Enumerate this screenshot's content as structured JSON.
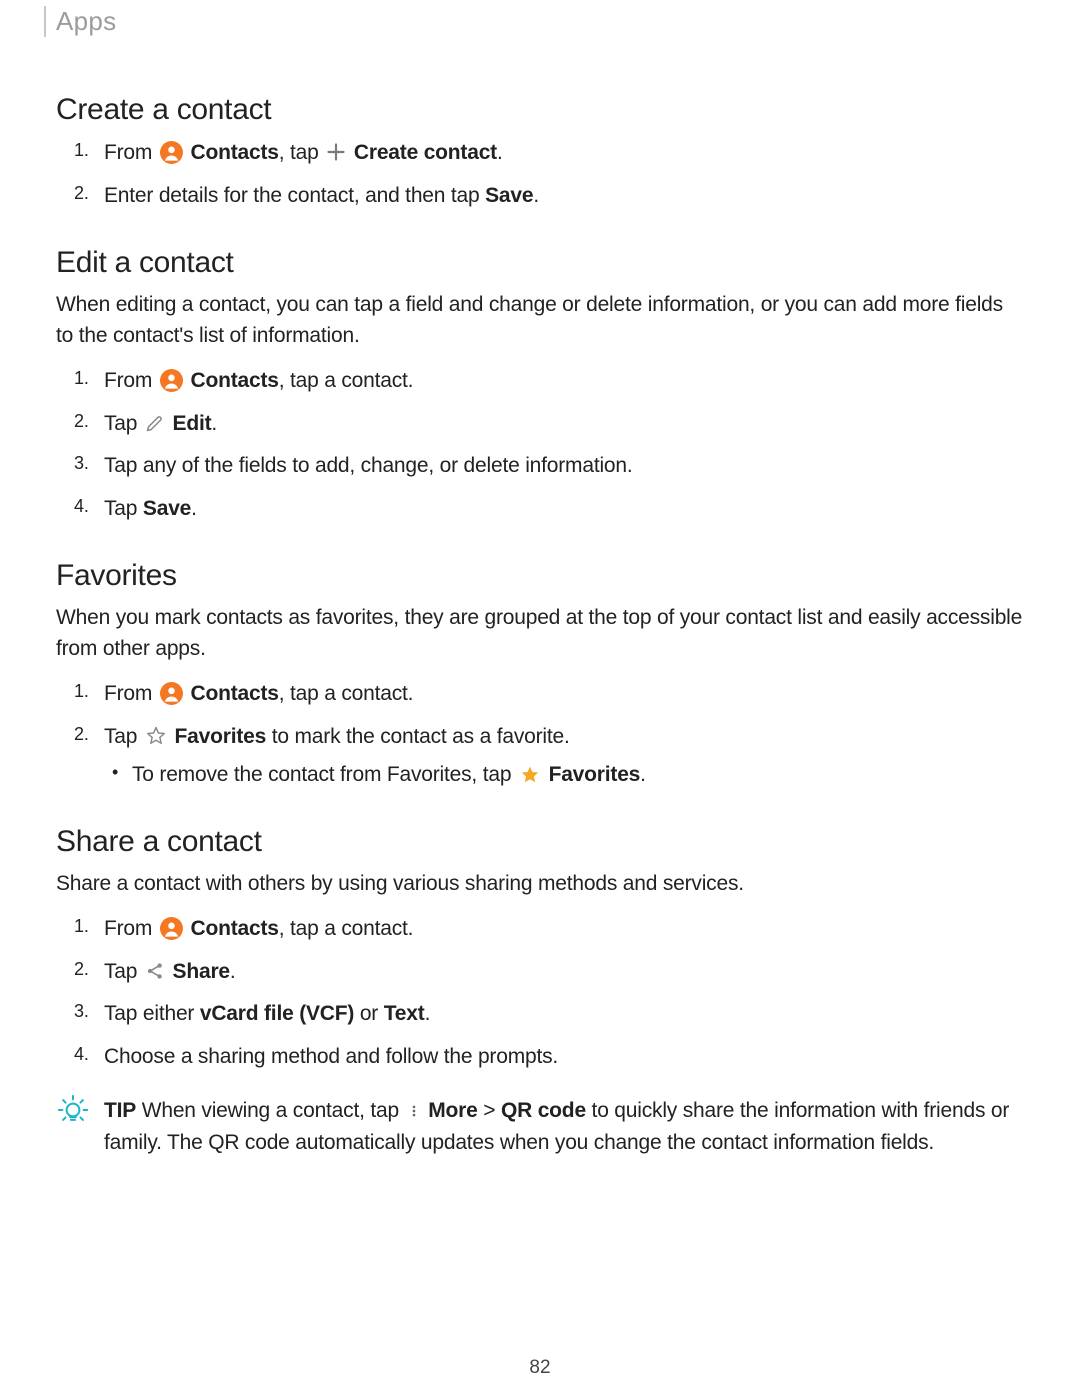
{
  "breadcrumb": "Apps",
  "page_number": "82",
  "sections": {
    "create": {
      "title": "Create a contact",
      "step1_from": "From",
      "step1_contacts": "Contacts",
      "step1_tap": ", tap",
      "step1_create": "Create contact",
      "step1_period": ".",
      "step2_a": "Enter details for the contact, and then tap ",
      "step2_save": "Save",
      "step2_b": "."
    },
    "edit": {
      "title": "Edit a contact",
      "intro": "When editing a contact, you can tap a field and change or delete information, or you can add more fields to the contact's list of information.",
      "step1_from": "From",
      "step1_contacts": "Contacts",
      "step1_rest": ", tap a contact.",
      "step2_tap": "Tap",
      "step2_edit": "Edit",
      "step2_period": ".",
      "step3": "Tap any of the fields to add, change, or delete information.",
      "step4_a": "Tap ",
      "step4_save": "Save",
      "step4_b": "."
    },
    "fav": {
      "title": "Favorites",
      "intro": "When you mark contacts as favorites, they are grouped at the top of your contact list and easily accessible from other apps.",
      "step1_from": "From",
      "step1_contacts": "Contacts",
      "step1_rest": ", tap a contact.",
      "step2_tap": "Tap",
      "step2_fav": "Favorites",
      "step2_rest": " to mark the contact as a favorite.",
      "sub_a": "To remove the contact from Favorites, tap",
      "sub_fav": "Favorites",
      "sub_b": "."
    },
    "share": {
      "title": "Share a contact",
      "intro": "Share a contact with others by using various sharing methods and services.",
      "step1_from": "From",
      "step1_contacts": "Contacts",
      "step1_rest": ", tap a contact.",
      "step2_tap": "Tap",
      "step2_share": "Share",
      "step2_period": ".",
      "step3_a": "Tap either ",
      "step3_vcf": "vCard file (VCF)",
      "step3_or": " or ",
      "step3_text": "Text",
      "step3_b": ".",
      "step4": "Choose a sharing method and follow the prompts."
    },
    "tip": {
      "label": "TIP",
      "a": "  When viewing a contact, tap",
      "more": "More",
      "gt": " > ",
      "qr": "QR code",
      "b": " to quickly share the information with friends or family. The QR code automatically updates when you change the contact information fields."
    }
  }
}
